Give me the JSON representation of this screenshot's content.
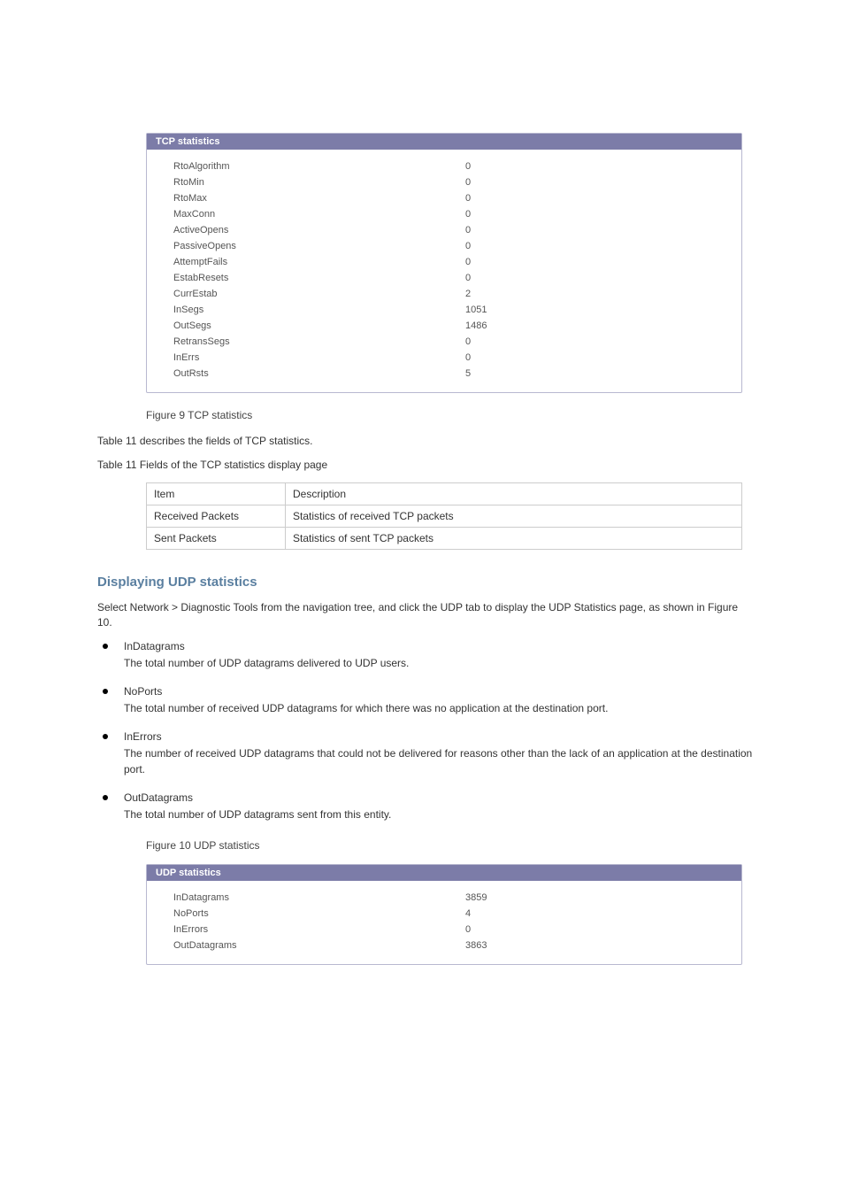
{
  "tcp_panel": {
    "title": "TCP statistics",
    "rows": [
      {
        "label": "RtoAlgorithm",
        "value": "0"
      },
      {
        "label": "RtoMin",
        "value": "0"
      },
      {
        "label": "RtoMax",
        "value": "0"
      },
      {
        "label": "MaxConn",
        "value": "0"
      },
      {
        "label": "ActiveOpens",
        "value": "0"
      },
      {
        "label": "PassiveOpens",
        "value": "0"
      },
      {
        "label": "AttemptFails",
        "value": "0"
      },
      {
        "label": "EstabResets",
        "value": "0"
      },
      {
        "label": "CurrEstab",
        "value": "2"
      },
      {
        "label": "InSegs",
        "value": "1051"
      },
      {
        "label": "OutSegs",
        "value": "1486"
      },
      {
        "label": "RetransSegs",
        "value": "0"
      },
      {
        "label": "InErrs",
        "value": "0"
      },
      {
        "label": "OutRsts",
        "value": "5"
      }
    ]
  },
  "fig9_caption": "Figure 9 TCP statistics",
  "tcp_table_caption": "Table 11 describes the fields of TCP statistics.",
  "tcp_table_title": "Table 11 Fields of the TCP statistics display page",
  "tcp_table_header": {
    "item": "Item",
    "desc": "Description"
  },
  "tcp_table_rows": [
    {
      "item": "Received Packets",
      "desc": "Statistics of received TCP packets"
    },
    {
      "item": "Sent Packets",
      "desc": "Statistics of sent TCP packets"
    }
  ],
  "udp_heading": "Displaying UDP statistics",
  "udp_intro": "Select Network > Diagnostic Tools from the navigation tree, and click the UDP tab to display the UDP Statistics page, as shown in Figure 10.",
  "udp_bullets": [
    {
      "head": "InDatagrams",
      "desc": "The total number of UDP datagrams delivered to UDP users."
    },
    {
      "head": "NoPorts",
      "desc": "The total number of received UDP datagrams for which there was no application at the destination port."
    },
    {
      "head": "InErrors",
      "desc": "The number of received UDP datagrams that could not be delivered for reasons other than the lack of an application at the destination port."
    },
    {
      "head": "OutDatagrams",
      "desc": "The total number of UDP datagrams sent from this entity."
    }
  ],
  "fig10_caption": "Figure 10 UDP statistics",
  "udp_panel": {
    "title": "UDP statistics",
    "rows": [
      {
        "label": "InDatagrams",
        "value": "3859"
      },
      {
        "label": "NoPorts",
        "value": "4"
      },
      {
        "label": "InErrors",
        "value": "0"
      },
      {
        "label": "OutDatagrams",
        "value": "3863"
      }
    ]
  }
}
